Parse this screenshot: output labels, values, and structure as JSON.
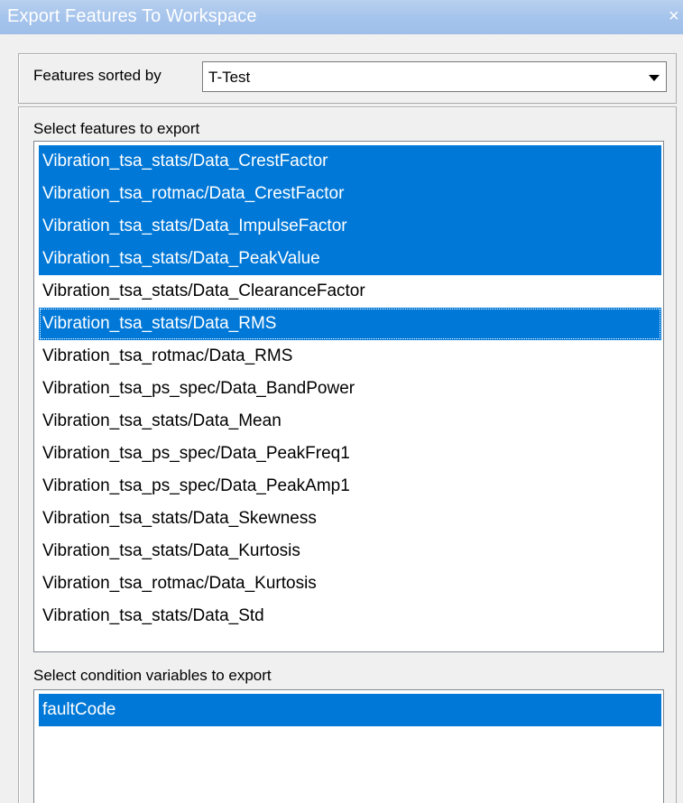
{
  "window": {
    "title": "Export Features To Workspace",
    "close_glyph": "×"
  },
  "sort": {
    "label": "Features sorted by",
    "selected": "T-Test"
  },
  "features": {
    "label": "Select features to export",
    "items": [
      {
        "label": "Vibration_tsa_stats/Data_CrestFactor",
        "selected": true
      },
      {
        "label": "Vibration_tsa_rotmac/Data_CrestFactor",
        "selected": true
      },
      {
        "label": "Vibration_tsa_stats/Data_ImpulseFactor",
        "selected": true
      },
      {
        "label": "Vibration_tsa_stats/Data_PeakValue",
        "selected": true
      },
      {
        "label": "Vibration_tsa_stats/Data_ClearanceFactor",
        "selected": false
      },
      {
        "label": "Vibration_tsa_stats/Data_RMS",
        "selected": true,
        "focused": true
      },
      {
        "label": "Vibration_tsa_rotmac/Data_RMS",
        "selected": false
      },
      {
        "label": "Vibration_tsa_ps_spec/Data_BandPower",
        "selected": false
      },
      {
        "label": "Vibration_tsa_stats/Data_Mean",
        "selected": false
      },
      {
        "label": "Vibration_tsa_ps_spec/Data_PeakFreq1",
        "selected": false
      },
      {
        "label": "Vibration_tsa_ps_spec/Data_PeakAmp1",
        "selected": false
      },
      {
        "label": "Vibration_tsa_stats/Data_Skewness",
        "selected": false
      },
      {
        "label": "Vibration_tsa_stats/Data_Kurtosis",
        "selected": false
      },
      {
        "label": "Vibration_tsa_rotmac/Data_Kurtosis",
        "selected": false
      },
      {
        "label": "Vibration_tsa_stats/Data_Std",
        "selected": false
      }
    ]
  },
  "conditions": {
    "label": "Select condition variables to export",
    "items": [
      {
        "label": "faultCode",
        "selected": true
      }
    ]
  },
  "colors": {
    "selection": "#0078d7",
    "titlebar": "#a6c4ec"
  }
}
